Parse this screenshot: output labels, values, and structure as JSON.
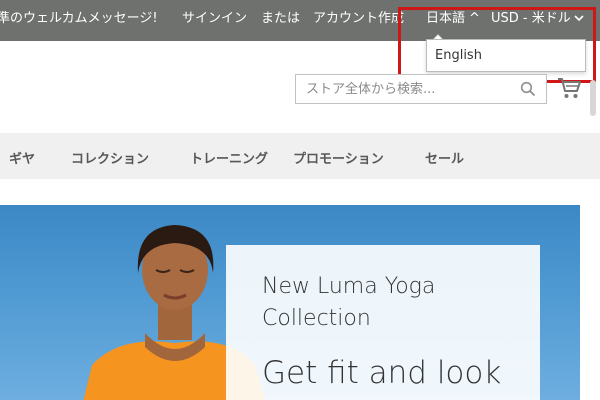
{
  "topbar": {
    "welcome": "準のウェルカムメッセージ!",
    "signin": "サインイン",
    "or": "または",
    "create_account": "アカウント作成",
    "language": "日本語",
    "currency": "USD - 米ドル"
  },
  "language_dropdown": {
    "options": [
      "English"
    ]
  },
  "search": {
    "placeholder": "ストア全体から検索..."
  },
  "nav": {
    "items": [
      "ギヤ",
      "コレクション",
      "トレーニング",
      "プロモーション",
      "セール"
    ]
  },
  "hero": {
    "title": "New Luma Yoga Collection",
    "subtitle": "Get fit and look"
  },
  "colors": {
    "topbar": "#6e716e",
    "highlight": "#d01717",
    "nav_bg": "#f0f0f0",
    "hero_blue": "#4f9ad2",
    "shirt": "#f5941f"
  }
}
